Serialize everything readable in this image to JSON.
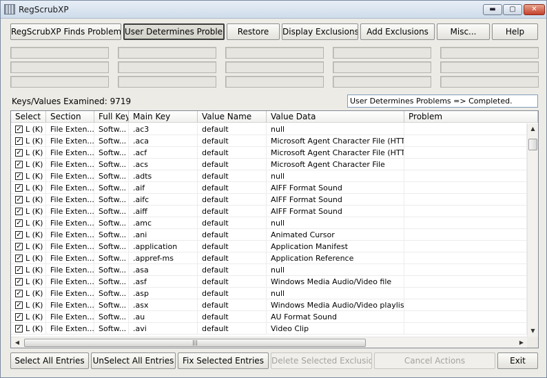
{
  "window": {
    "title": "RegScrubXP",
    "min": "▬",
    "max": "▢",
    "close": "✕"
  },
  "toolbar": {
    "buttons": [
      "RegScrubXP Finds Problems",
      "User Determines Problems",
      "Restore",
      "Display Exclusions",
      "Add Exclusions",
      "Misc...",
      "Help"
    ],
    "active_index": 1
  },
  "status": {
    "keys_examined": "Keys/Values Examined: 9719",
    "message": "User Determines Problems => Completed."
  },
  "grid": {
    "columns": [
      "Select",
      "Section",
      "Full Key",
      "Main Key",
      "Value Name",
      "Value Data",
      "Problem"
    ],
    "rows": [
      {
        "checked": true,
        "select": "L (K)",
        "section": "File Exten...",
        "full_key": "Softw...",
        "main_key": ".ac3",
        "value_name": "default",
        "value_data": "null",
        "problem": ""
      },
      {
        "checked": true,
        "select": "L (K)",
        "section": "File Exten...",
        "full_key": "Softw...",
        "main_key": ".aca",
        "value_name": "default",
        "value_data": "Microsoft Agent Character File (HTTP...",
        "problem": ""
      },
      {
        "checked": true,
        "select": "L (K)",
        "section": "File Exten...",
        "full_key": "Softw...",
        "main_key": ".acf",
        "value_name": "default",
        "value_data": "Microsoft Agent Character File (HTTP...",
        "problem": ""
      },
      {
        "checked": true,
        "select": "L (K)",
        "section": "File Exten...",
        "full_key": "Softw...",
        "main_key": ".acs",
        "value_name": "default",
        "value_data": "Microsoft Agent Character File",
        "problem": ""
      },
      {
        "checked": true,
        "select": "L (K)",
        "section": "File Exten...",
        "full_key": "Softw...",
        "main_key": ".adts",
        "value_name": "default",
        "value_data": "null",
        "problem": ""
      },
      {
        "checked": true,
        "select": "L (K)",
        "section": "File Exten...",
        "full_key": "Softw...",
        "main_key": ".aif",
        "value_name": "default",
        "value_data": "AIFF Format Sound",
        "problem": ""
      },
      {
        "checked": true,
        "select": "L (K)",
        "section": "File Exten...",
        "full_key": "Softw...",
        "main_key": ".aifc",
        "value_name": "default",
        "value_data": "AIFF Format Sound",
        "problem": ""
      },
      {
        "checked": true,
        "select": "L (K)",
        "section": "File Exten...",
        "full_key": "Softw...",
        "main_key": ".aiff",
        "value_name": "default",
        "value_data": "AIFF Format Sound",
        "problem": ""
      },
      {
        "checked": true,
        "select": "L (K)",
        "section": "File Exten...",
        "full_key": "Softw...",
        "main_key": ".amc",
        "value_name": "default",
        "value_data": "null",
        "problem": ""
      },
      {
        "checked": true,
        "select": "L (K)",
        "section": "File Exten...",
        "full_key": "Softw...",
        "main_key": ".ani",
        "value_name": "default",
        "value_data": "Animated Cursor",
        "problem": ""
      },
      {
        "checked": true,
        "select": "L (K)",
        "section": "File Exten...",
        "full_key": "Softw...",
        "main_key": ".application",
        "value_name": "default",
        "value_data": "Application Manifest",
        "problem": ""
      },
      {
        "checked": true,
        "select": "L (K)",
        "section": "File Exten...",
        "full_key": "Softw...",
        "main_key": ".appref-ms",
        "value_name": "default",
        "value_data": "Application Reference",
        "problem": ""
      },
      {
        "checked": true,
        "select": "L (K)",
        "section": "File Exten...",
        "full_key": "Softw...",
        "main_key": ".asa",
        "value_name": "default",
        "value_data": "null",
        "problem": ""
      },
      {
        "checked": true,
        "select": "L (K)",
        "section": "File Exten...",
        "full_key": "Softw...",
        "main_key": ".asf",
        "value_name": "default",
        "value_data": "Windows Media Audio/Video file",
        "problem": ""
      },
      {
        "checked": true,
        "select": "L (K)",
        "section": "File Exten...",
        "full_key": "Softw...",
        "main_key": ".asp",
        "value_name": "default",
        "value_data": "null",
        "problem": ""
      },
      {
        "checked": true,
        "select": "L (K)",
        "section": "File Exten...",
        "full_key": "Softw...",
        "main_key": ".asx",
        "value_name": "default",
        "value_data": "Windows Media Audio/Video playlist",
        "problem": ""
      },
      {
        "checked": true,
        "select": "L (K)",
        "section": "File Exten...",
        "full_key": "Softw...",
        "main_key": ".au",
        "value_name": "default",
        "value_data": "AU Format Sound",
        "problem": ""
      },
      {
        "checked": true,
        "select": "L (K)",
        "section": "File Exten...",
        "full_key": "Softw...",
        "main_key": ".avi",
        "value_name": "default",
        "value_data": "Video Clip",
        "problem": ""
      }
    ]
  },
  "bottom_buttons": [
    {
      "label": "Select All Entries",
      "enabled": true
    },
    {
      "label": "UnSelect All Entries",
      "enabled": true
    },
    {
      "label": "Fix Selected Entries",
      "enabled": true
    },
    {
      "label": "Delete Selected Exclusions",
      "enabled": false
    },
    {
      "label": "Cancel Actions",
      "enabled": false
    },
    {
      "label": "Exit",
      "enabled": true
    }
  ],
  "colors": {
    "window_bg": "#ecebe6",
    "grid_bg": "#ffffff",
    "disabled_text": "#a4a39e"
  }
}
